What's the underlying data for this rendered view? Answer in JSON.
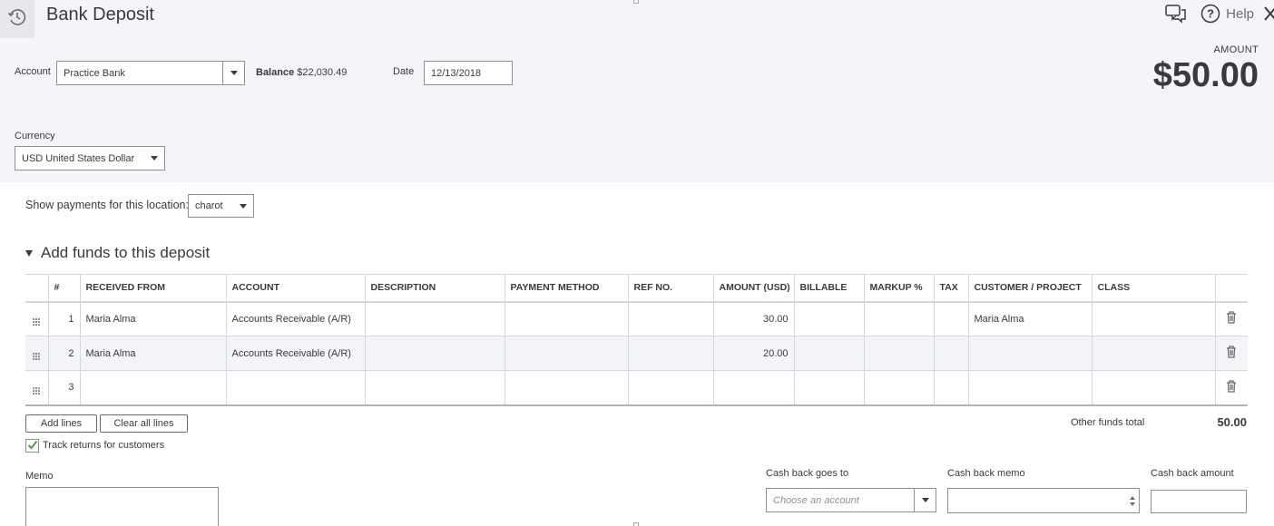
{
  "header": {
    "title": "Bank Deposit",
    "help_label": "Help"
  },
  "account": {
    "label": "Account",
    "value": "Practice Bank",
    "balance_label": "Balance",
    "balance_value": "$22,030.49"
  },
  "date": {
    "label": "Date",
    "value": "12/13/2018"
  },
  "amount": {
    "label": "AMOUNT",
    "value": "$50.00"
  },
  "currency": {
    "label": "Currency",
    "value": "USD United States Dollar"
  },
  "location": {
    "label": "Show payments for this location:",
    "value": "charot"
  },
  "funds": {
    "title": "Add funds to this deposit",
    "columns": [
      "#",
      "RECEIVED FROM",
      "ACCOUNT",
      "DESCRIPTION",
      "PAYMENT METHOD",
      "REF NO.",
      "AMOUNT (USD)",
      "BILLABLE",
      "MARKUP %",
      "TAX",
      "CUSTOMER / PROJECT",
      "CLASS"
    ],
    "rows": [
      {
        "num": "1",
        "received_from": "Maria Alma",
        "account": "Accounts Receivable (A/R)",
        "description": "",
        "payment_method": "",
        "ref_no": "",
        "amount": "30.00",
        "billable": "",
        "markup": "",
        "tax": "",
        "customer": "Maria Alma",
        "class": ""
      },
      {
        "num": "2",
        "received_from": "Maria Alma",
        "account": "Accounts Receivable (A/R)",
        "description": "",
        "payment_method": "",
        "ref_no": "",
        "amount": "20.00",
        "billable": "",
        "markup": "",
        "tax": "",
        "customer": "",
        "class": ""
      },
      {
        "num": "3",
        "received_from": "",
        "account": "",
        "description": "",
        "payment_method": "",
        "ref_no": "",
        "amount": "",
        "billable": "",
        "markup": "",
        "tax": "",
        "customer": "",
        "class": ""
      }
    ],
    "add_lines_label": "Add lines",
    "clear_lines_label": "Clear all lines",
    "other_total_label": "Other funds total",
    "other_total_value": "50.00",
    "track_returns_label": "Track returns for customers",
    "track_returns_checked": true
  },
  "memo": {
    "label": "Memo",
    "value": ""
  },
  "cash_back": {
    "goes_to_label": "Cash back goes to",
    "goes_to_placeholder": "Choose an account",
    "memo_label": "Cash back memo",
    "amount_label": "Cash back amount"
  },
  "colors": {
    "header_bg": "#f4f5f8",
    "check_green": "#2ca01c",
    "text": "#393a3d"
  }
}
